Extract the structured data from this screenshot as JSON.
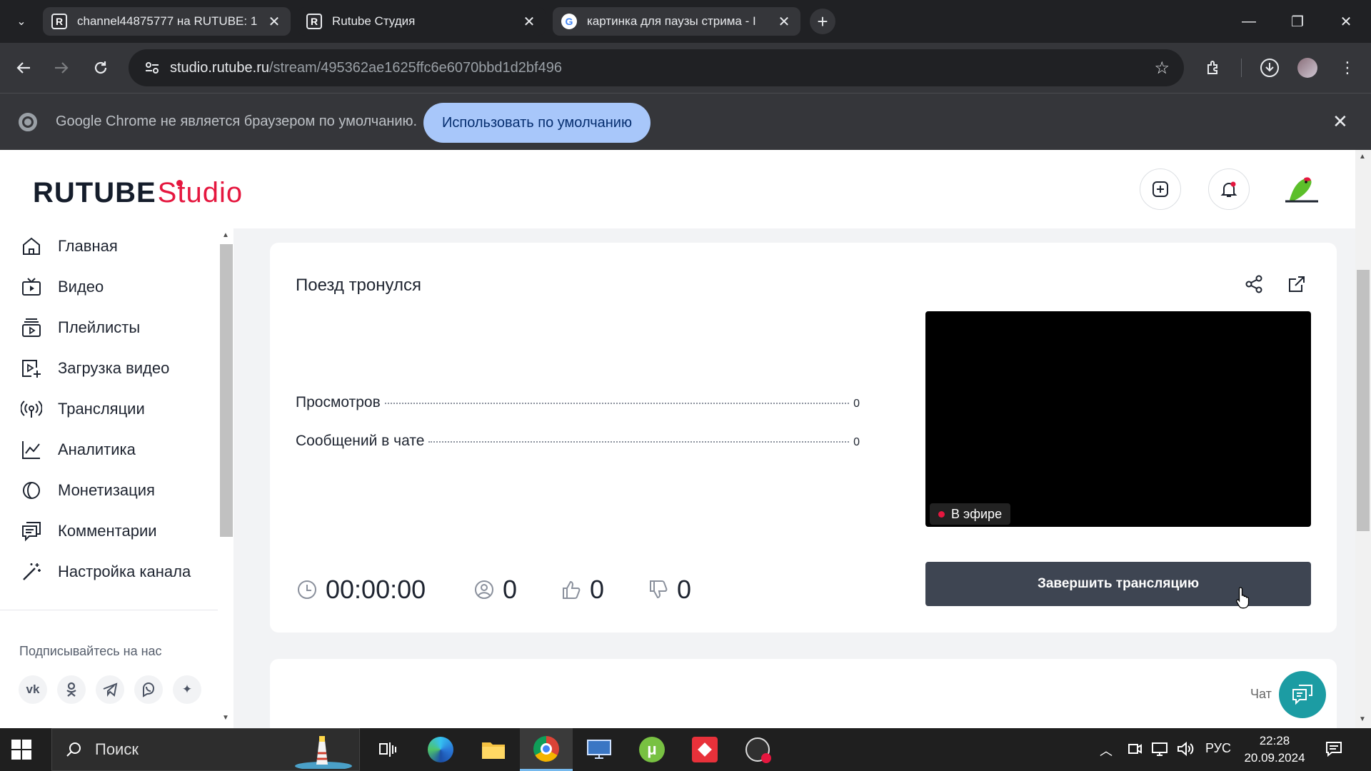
{
  "browser": {
    "tabs": [
      {
        "title": "channel44875777 на RUTUBE: 1",
        "favicon": "rutube-favicon",
        "active": false
      },
      {
        "title": "Rutube Студия",
        "favicon": "rutube-favicon",
        "active": true
      },
      {
        "title": "картинка для паузы стрима - I",
        "favicon": "google-favicon",
        "active": false
      }
    ],
    "url_host": "studio.rutube.ru",
    "url_path": "/stream/495362ae1625ffc6e6070bbd1d2bf496",
    "infobar": {
      "message": "Google Chrome не является браузером по умолчанию.",
      "button": "Использовать по умолчанию"
    }
  },
  "header": {
    "logo_main": "RUTUBE",
    "logo_sub": "Studio"
  },
  "sidebar": {
    "items": [
      {
        "label": "Главная",
        "icon": "home-icon"
      },
      {
        "label": "Видео",
        "icon": "video-icon"
      },
      {
        "label": "Плейлисты",
        "icon": "playlist-icon"
      },
      {
        "label": "Загрузка видео",
        "icon": "upload-video-icon"
      },
      {
        "label": "Трансляции",
        "icon": "broadcast-icon"
      },
      {
        "label": "Аналитика",
        "icon": "analytics-icon"
      },
      {
        "label": "Монетизация",
        "icon": "monetization-icon"
      },
      {
        "label": "Комментарии",
        "icon": "comments-icon"
      },
      {
        "label": "Настройка канала",
        "icon": "channel-settings-icon"
      }
    ],
    "follow_label": "Подписывайтесь на нас",
    "social": [
      {
        "label": "vk",
        "icon": "vk-icon"
      },
      {
        "label": "ok",
        "icon": "odnoklassniki-icon"
      },
      {
        "label": "tg",
        "icon": "telegram-icon"
      },
      {
        "label": "viber",
        "icon": "viber-icon"
      },
      {
        "label": "more",
        "icon": "sparkle-icon"
      }
    ]
  },
  "stream": {
    "title": "Поезд тронулся",
    "stats": [
      {
        "label": "Просмотров",
        "value": "0"
      },
      {
        "label": "Сообщений в чате",
        "value": "0"
      }
    ],
    "live_badge": "В эфире",
    "end_button": "Завершить трансляцию",
    "duration": "00:00:00",
    "viewers": "0",
    "likes": "0",
    "dislikes": "0"
  },
  "chat": {
    "label": "Чат"
  },
  "taskbar": {
    "search_text": "Поиск",
    "language": "РУС",
    "time": "22:28",
    "date": "20.09.2024"
  },
  "colors": {
    "brand_red": "#e5173f",
    "end_button_bg": "#3e4552",
    "chat_fab": "#1c9ca3"
  }
}
